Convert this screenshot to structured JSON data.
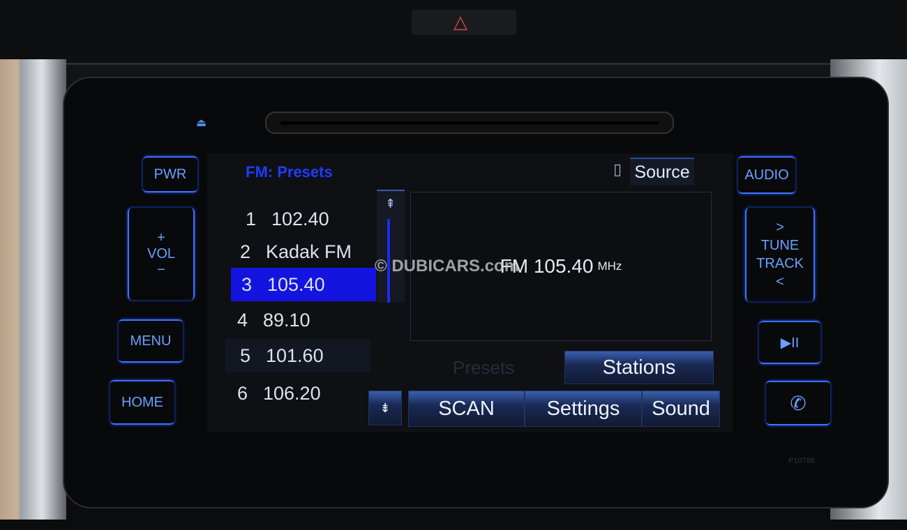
{
  "hardkeys": {
    "power": "PWR",
    "vol_plus": "+",
    "vol": "VOL",
    "vol_minus": "−",
    "menu": "MENU",
    "home": "HOME",
    "audio": "AUDIO",
    "tune_up": ">",
    "tune_track": "TUNE\nTRACK",
    "tune_down": "<",
    "play_pause": "▶II",
    "phone": "✆",
    "eject": "⏏"
  },
  "screen": {
    "title": "FM: Presets",
    "source_label": "Source",
    "presets": [
      {
        "num": "1",
        "label": "102.40"
      },
      {
        "num": "2",
        "label": "Kadak FM"
      },
      {
        "num": "3",
        "label": "105.40",
        "selected": true
      },
      {
        "num": "4",
        "label": "89.10"
      },
      {
        "num": "5",
        "label": "101.60"
      },
      {
        "num": "6",
        "label": "106.20"
      }
    ],
    "now_playing": {
      "band": "FM",
      "frequency": "105.40",
      "unit": "MHz"
    },
    "presets_tab": "Presets",
    "stations_button": "Stations",
    "scan_button": "SCAN",
    "settings_button": "Settings",
    "sound_button": "Sound"
  },
  "watermark": "© DUBICARS.com",
  "panel_code": "P10788",
  "colors": {
    "accent": "#1f3cff",
    "selected_row": "#1414e0",
    "hardkey_glow": "#3c72ff"
  }
}
